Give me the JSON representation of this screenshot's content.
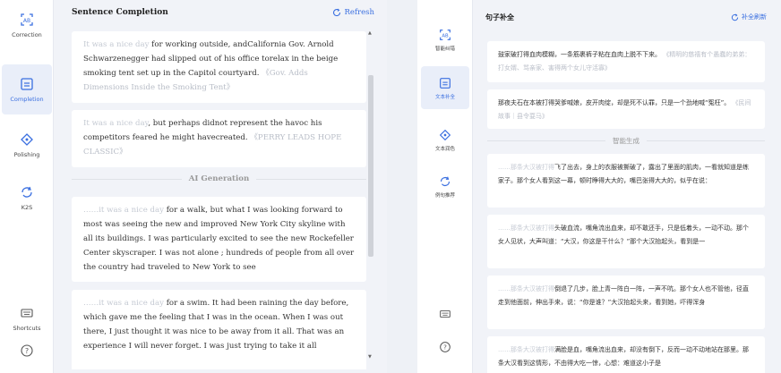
{
  "left": {
    "sidebar": {
      "items": [
        {
          "label": "Correction",
          "icon": "ab-correction-icon"
        },
        {
          "label": "Completion",
          "icon": "completion-icon",
          "active": true
        },
        {
          "label": "Polishing",
          "icon": "diamond-icon"
        },
        {
          "label": "K2S",
          "icon": "k2s-refresh-icon"
        }
      ],
      "shortcuts": "Shortcuts",
      "help": "?"
    },
    "title": "Sentence Completion",
    "refresh": "Refresh",
    "cards": [
      {
        "hint": "It was a nice day",
        "text": " for working outside, andCalifornia Gov. Arnold Schwarzenegger had slipped out of his office torelax in the beige smoking tent set up in the Capitol courtyard.",
        "source": "《Gov. Adds Dimensions Inside the Smoking Tent》"
      },
      {
        "hint": "It was a nice day",
        "text": ", but perhaps didnot represent the havoc his competitors feared he might havecreated.",
        "source": "《PERRY LEADS HOPE CLASSIC》"
      }
    ],
    "divider": "AI Generation",
    "gen_cards": [
      {
        "hint": "……it was a nice day",
        "text": " for a walk, but what I was looking forward to most was seeing the new and improved New York City skyline with all its buildings. I was particularly excited to see the new Rockefeller Center skyscraper. I was not alone ; hundreds of people from all over the country had traveled to New York to see"
      },
      {
        "hint": "……it was a nice day",
        "text": " for a swim. It had been raining the day before, which gave me the feeling that I was in the ocean. When I was out there, I just thought it was nice to be away from it all. That was an experience I will never forget. I was just trying to take it all"
      }
    ]
  },
  "right": {
    "sidebar": {
      "items": [
        {
          "label": "智能纠错",
          "icon": "ab-correction-icon"
        },
        {
          "label": "文本补全",
          "icon": "completion-icon",
          "active": true
        },
        {
          "label": "文本润色",
          "icon": "diamond-icon"
        },
        {
          "label": "例句推荐",
          "icon": "k2s-refresh-icon"
        }
      ],
      "shortcuts_icon": "keyboard-icon",
      "help": "?"
    },
    "title": "句子补全",
    "refresh": "补全刷新",
    "cards": [
      {
        "hint": "",
        "text": "鼓家破打得血肉模糊，一条筋裹裤子粘在血肉上脱不下来。",
        "source": "《精明的慈禧有个愚蠢的弟弟：打女婿、骂亲家、害得两个女儿守活寡》"
      },
      {
        "hint": "",
        "text": "那夜夫石在本被打得哭爹喊娘，皮开肉绽，却是死不认罪，只是一个劲地喊“冤枉”。",
        "source": "《民间故事｜县令耍马》"
      }
    ],
    "divider": "智能生成",
    "gen_cards": [
      {
        "hint": "……那条大汉被打得",
        "text": "飞了出去，身上的衣服被撕破了，露出了里面的肌肉，一看就知道是练家子。那个女人看到这一幕，顿时睁得大大的，嘴巴张得大大的，似乎在说："
      },
      {
        "hint": "……那条大汉被打得",
        "text": "头破血流，嘴角流出血来，却不敢还手，只是低着头，一动不动。那个女人见状，大声叫道：“大汉，你这是干什么？”那个大汉抬起头，看到是一"
      },
      {
        "hint": "……那条大汉被打得",
        "text": "倒退了几步，脸上青一阵白一阵，一声不吭。那个女人也不管他，径直走到他面前，伸出手来，说：“你是谁？”大汉抬起头来，看到她，吓得浑身"
      },
      {
        "hint": "……那条大汉被打得",
        "text": "满脸是血，嘴角流出血来，却没有倒下，反而一动不动地站在那里。那条大汉看到这情形，不由得大吃一惊，心想：难道这小子是"
      }
    ]
  }
}
